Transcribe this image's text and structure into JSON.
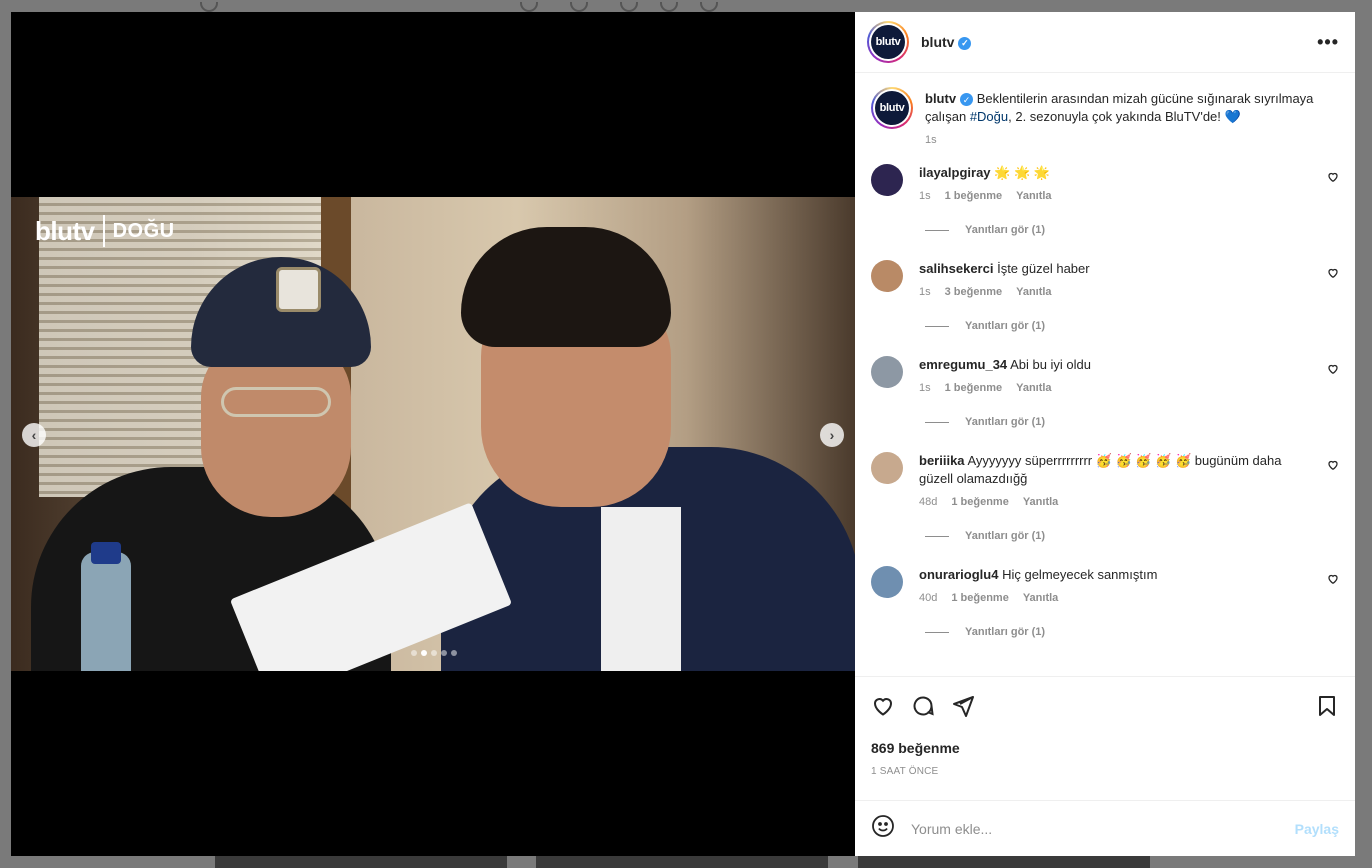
{
  "post": {
    "account": "blutv",
    "logo_text": "blutv",
    "caption_text": "Beklentilerin arasından mizah gücüne sığınarak sıyrılmaya çalışan ",
    "caption_hashtag": "#Doğu",
    "caption_rest": ", 2. sezonuyla çok yakında BluTV'de! ",
    "caption_emoji": "💙",
    "caption_time": "1s",
    "likes": "869 beğenme",
    "time_ago": "1 SAAT ÖNCE",
    "more_icon": "•••"
  },
  "media": {
    "watermark_brand": "blutv",
    "watermark_show": "DOĞU",
    "prev_icon": "‹",
    "next_icon": "›",
    "slide_count": 5,
    "active_slide": 2
  },
  "comments": [
    {
      "user": "ilayalpgiray",
      "text": "🌟 🌟 🌟",
      "time": "1s",
      "likes": "1 beğenme",
      "reply": "Yanıtla",
      "view_replies": "Yanıtları gör (1)",
      "avatar_color": "#2d2550"
    },
    {
      "user": "salihsekerci",
      "text": "İşte güzel haber",
      "time": "1s",
      "likes": "3 beğenme",
      "reply": "Yanıtla",
      "view_replies": "Yanıtları gör (1)",
      "avatar_color": "#b98a66"
    },
    {
      "user": "emregumu_34",
      "text": "Abi bu iyi oldu",
      "time": "1s",
      "likes": "1 beğenme",
      "reply": "Yanıtla",
      "view_replies": "Yanıtları gör (1)",
      "avatar_color": "#8d98a4"
    },
    {
      "user": "beriiika",
      "text": "Ayyyyyyy süperrrrrrrrr 🥳 🥳 🥳 🥳 🥳  bugünüm daha güzell olamazdıığğ",
      "time": "48d",
      "likes": "1 beğenme",
      "reply": "Yanıtla",
      "view_replies": "Yanıtları gör (1)",
      "avatar_color": "#c7a98e"
    },
    {
      "user": "onurarioglu4",
      "text": "Hiç gelmeyecek sanmıştım",
      "time": "40d",
      "likes": "1 beğenme",
      "reply": "Yanıtla",
      "view_replies": "Yanıtları gör (1)",
      "avatar_color": "#6f8fb0"
    }
  ],
  "composer": {
    "placeholder": "Yorum ekle...",
    "post_label": "Paylaş"
  },
  "colors": {
    "verified": "#3897f0",
    "post_button": "#b2dffc"
  }
}
